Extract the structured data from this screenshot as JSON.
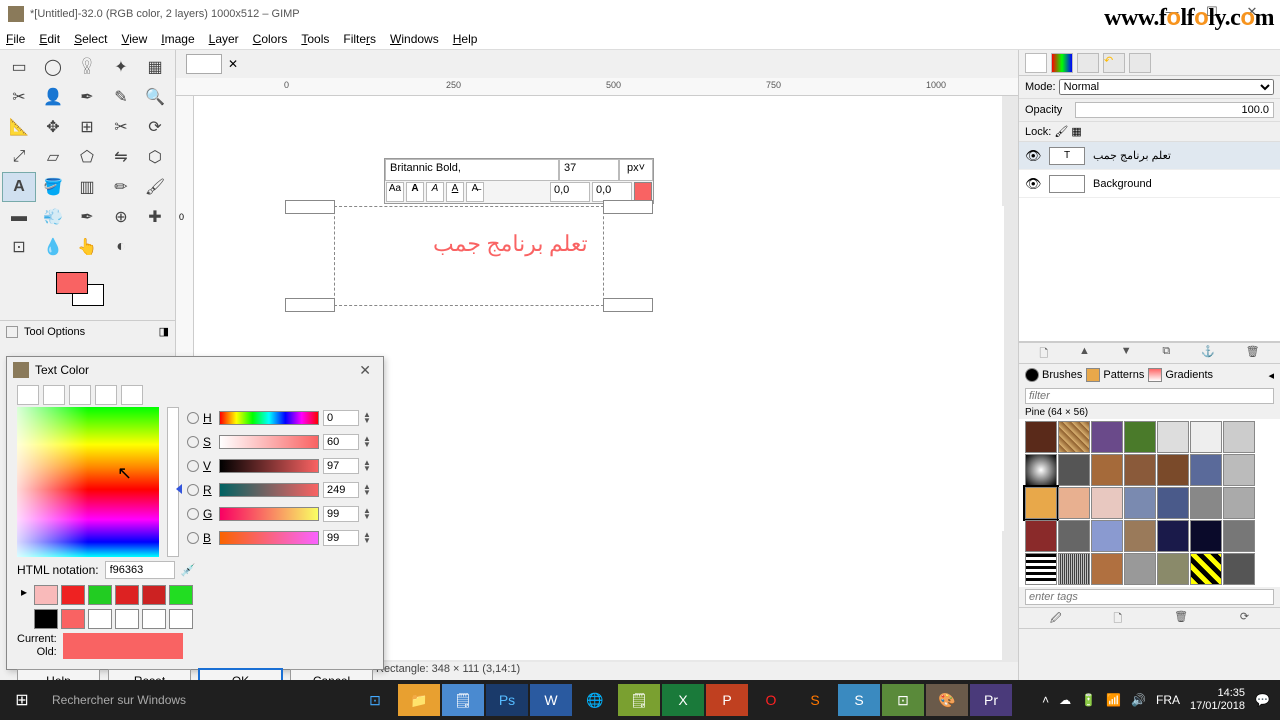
{
  "window": {
    "title": "*[Untitled]-32.0 (RGB color, 2 layers) 1000x512 – GIMP"
  },
  "watermark": "www.folfoly.com",
  "menu": {
    "file": "File",
    "edit": "Edit",
    "select": "Select",
    "view": "View",
    "image": "Image",
    "layer": "Layer",
    "colors": "Colors",
    "tools": "Tools",
    "filters": "Filters",
    "windows": "Windows",
    "help": "Help"
  },
  "tool_options": {
    "header": "Tool Options"
  },
  "ruler": {
    "t0": "0",
    "t250": "250",
    "t500": "500",
    "t750": "750",
    "t1000": "1000",
    "v0": "0"
  },
  "text_opts": {
    "font": "Britannic Bold,",
    "size": "37",
    "unit": "px˅",
    "kern": "0,0",
    "baseline": "0,0"
  },
  "canvas_text": "تعلم برنامج جمب",
  "status": "Rectangle: 348 × 111   (3,14:1)",
  "rpanel": {
    "mode_label": "Mode:",
    "mode_value": "Normal",
    "opacity_label": "Opacity",
    "opacity_value": "100.0",
    "lock_label": "Lock:",
    "layer1": "تعلم برنامج جمب",
    "layer2": "Background",
    "tabs": {
      "brushes": "Brushes",
      "patterns": "Patterns",
      "gradients": "Gradients"
    },
    "filter_placeholder": "filter",
    "pattern_name": "Pine (64 × 56)",
    "tags_placeholder": "enter tags"
  },
  "dlg": {
    "title": "Text Color",
    "H": {
      "l": "H",
      "v": "0"
    },
    "S": {
      "l": "S",
      "v": "60"
    },
    "V": {
      "l": "V",
      "v": "97"
    },
    "R": {
      "l": "R",
      "v": "249"
    },
    "G": {
      "l": "G",
      "v": "99"
    },
    "B": {
      "l": "B",
      "v": "99"
    },
    "html_label": "HTML notation:",
    "html_value": "f96363",
    "current_label": "Current:",
    "old_label": "Old:",
    "help": "Help",
    "reset": "Reset",
    "ok": "OK",
    "cancel": "Cancel"
  },
  "taskbar": {
    "search": "Rechercher sur Windows",
    "time": "14:35",
    "date": "17/01/2018"
  }
}
